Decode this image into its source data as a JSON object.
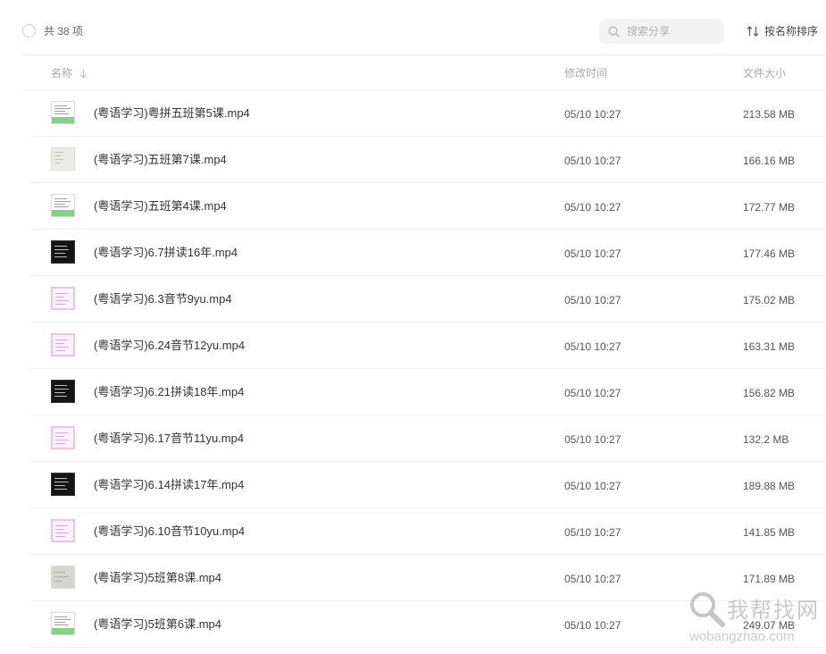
{
  "toolbar": {
    "count_label": "共 38 项",
    "search_placeholder": "搜索分享",
    "sort_label": "按名称排序",
    "icons": {
      "search": "search-icon",
      "sort": "sort-arrows-icon",
      "select_all": "circle-checkbox-icon"
    }
  },
  "columns": {
    "name": "名称",
    "modified": "修改时间",
    "size": "文件大小",
    "name_sort_icon": "arrow-down-icon"
  },
  "files": [
    {
      "name": "(粤语学习)粤拼五班第5课.mp4",
      "modified": "05/10 10:27",
      "size": "213.58 MB",
      "thumb": "green"
    },
    {
      "name": "(粤语学习)五班第7课.mp4",
      "modified": "05/10 10:27",
      "size": "166.16 MB",
      "thumb": "beige"
    },
    {
      "name": "(粤语学习)五班第4课.mp4",
      "modified": "05/10 10:27",
      "size": "172.77 MB",
      "thumb": "green"
    },
    {
      "name": "(粤语学习)6.7拼读16年.mp4",
      "modified": "05/10 10:27",
      "size": "177.46 MB",
      "thumb": "dark"
    },
    {
      "name": "(粤语学习)6.3音节9yu.mp4",
      "modified": "05/10 10:27",
      "size": "175.02 MB",
      "thumb": "pink"
    },
    {
      "name": "(粤语学习)6.24音节12yu.mp4",
      "modified": "05/10 10:27",
      "size": "163.31 MB",
      "thumb": "pink"
    },
    {
      "name": "(粤语学习)6.21拼读18年.mp4",
      "modified": "05/10 10:27",
      "size": "156.82 MB",
      "thumb": "dark"
    },
    {
      "name": "(粤语学习)6.17音节11yu.mp4",
      "modified": "05/10 10:27",
      "size": "132.2 MB",
      "thumb": "pink"
    },
    {
      "name": "(粤语学习)6.14拼读17年.mp4",
      "modified": "05/10 10:27",
      "size": "189.88 MB",
      "thumb": "dark"
    },
    {
      "name": "(粤语学习)6.10音节10yu.mp4",
      "modified": "05/10 10:27",
      "size": "141.85 MB",
      "thumb": "pink"
    },
    {
      "name": "(粤语学习)5班第8课.mp4",
      "modified": "05/10 10:27",
      "size": "171.89 MB",
      "thumb": "gray"
    },
    {
      "name": "(粤语学习)5班第6课.mp4",
      "modified": "05/10 10:27",
      "size": "249.07 MB",
      "thumb": "green"
    }
  ],
  "watermark": {
    "text": "我帮找网",
    "url": "wobangzhao.com"
  },
  "colors": {
    "divider": "#f0f0f0",
    "search_bg": "#f3f3f4",
    "thumb_green": "#7fd67f",
    "thumb_pink_border": "#ecc2e6",
    "thumb_dark": "#151515"
  }
}
